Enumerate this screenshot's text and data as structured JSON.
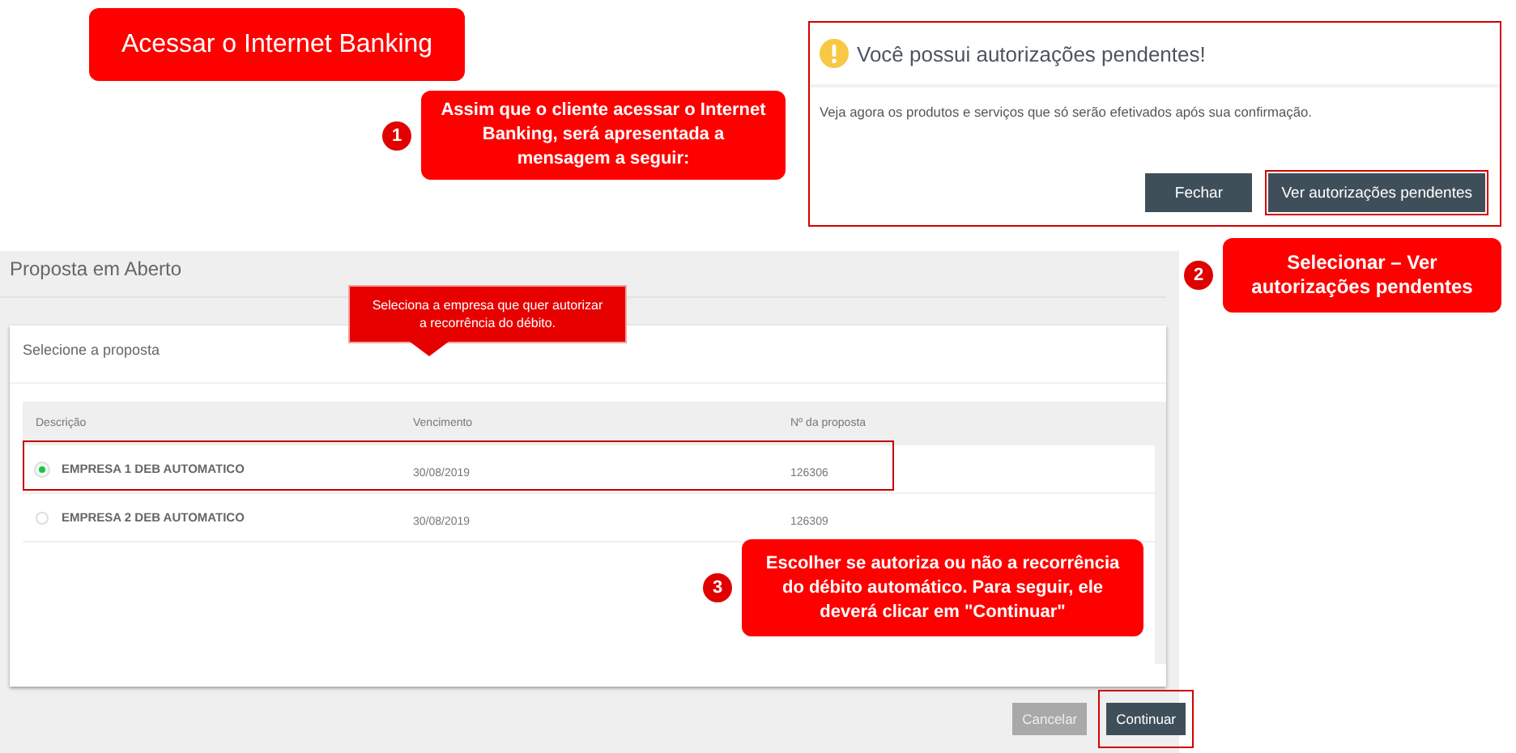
{
  "title_banner": {
    "text": "Acessar o Internet Banking"
  },
  "callouts": [
    {
      "number": "1",
      "text": "Assim que o cliente acessar o Internet Banking, será apresentada a mensagem a seguir:"
    },
    {
      "number": "2",
      "text": "Selecionar – Ver autorizações pendentes"
    },
    {
      "number": "3",
      "text": "Escolher se autoriza ou não a recorrência do débito automático. Para seguir, ele deverá clicar em \"Continuar\""
    }
  ],
  "dialog": {
    "title": "Você possui autorizações pendentes!",
    "message": "Veja agora os produtos e serviços que só serão efetivados após sua confirmação.",
    "buttons": [
      {
        "label": "Fechar",
        "highlighted": false
      },
      {
        "label": "Ver autorizações pendentes",
        "highlighted": true
      }
    ]
  },
  "proposal_screen": {
    "title": "Proposta em Aberto",
    "tooltip": "Seleciona a empresa que quer autorizar a recorrência do débito.",
    "section_title": "Selecione a proposta",
    "columns": [
      "Descrição",
      "Vencimento",
      "Nº da proposta"
    ],
    "rows": [
      {
        "selected": true,
        "highlighted": true,
        "cells": [
          "EMPRESA 1 DEB AUTOMATICO",
          "30/08/2019",
          "126306"
        ]
      },
      {
        "selected": false,
        "highlighted": false,
        "cells": [
          "EMPRESA 2 DEB AUTOMATICO",
          "30/08/2019",
          "126309"
        ]
      }
    ],
    "buttons": [
      {
        "label": "Cancelar",
        "kind": "secondary",
        "highlighted": false
      },
      {
        "label": "Continuar",
        "kind": "primary",
        "highlighted": true
      }
    ]
  }
}
